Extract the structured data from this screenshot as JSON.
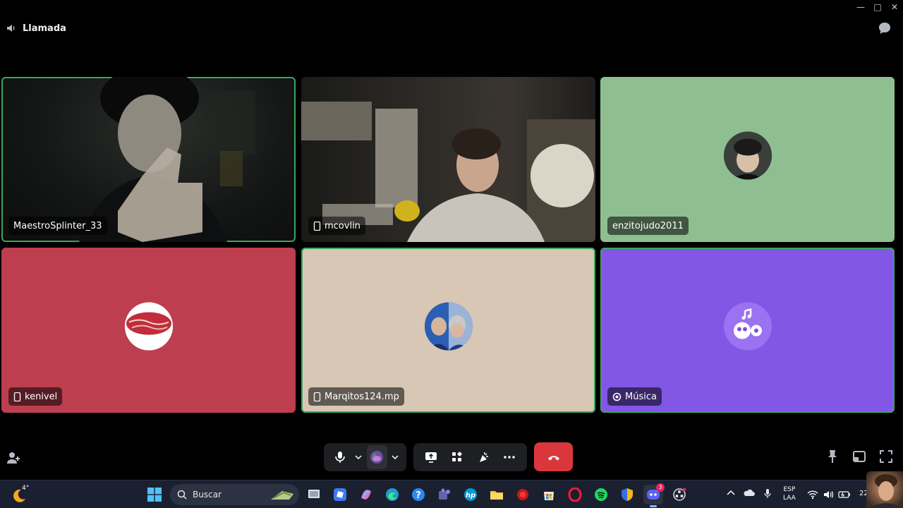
{
  "window": {
    "title": "Llamada"
  },
  "participants": [
    {
      "name": "MaestroSplinter_33",
      "type": "camera",
      "speaking": true,
      "mobile": false
    },
    {
      "name": "mcovlin",
      "type": "camera",
      "speaking": false,
      "mobile": true
    },
    {
      "name": "enzitojudo2011",
      "type": "avatar",
      "speaking": false,
      "mobile": false,
      "bg": "#8fbf90"
    },
    {
      "name": "kenivel",
      "type": "avatar",
      "speaking": false,
      "mobile": true,
      "bg": "#bd3f4f"
    },
    {
      "name": "Marqitos124.mp",
      "type": "avatar",
      "speaking": true,
      "mobile": true,
      "bg": "#d8c7b5"
    },
    {
      "name": "Música",
      "type": "bot",
      "speaking": true,
      "mobile": false,
      "bg": "#8257e6"
    }
  ],
  "colors": {
    "speaking_outline": "#3ba55d",
    "hangup": "#da373c",
    "bar": "#1e1f22"
  },
  "taskbar": {
    "weather_temp": "4°",
    "search_placeholder": "Buscar",
    "discord_badge": "3",
    "lang_top": "ESP",
    "lang_bottom": "LAA",
    "clock": "22/"
  }
}
